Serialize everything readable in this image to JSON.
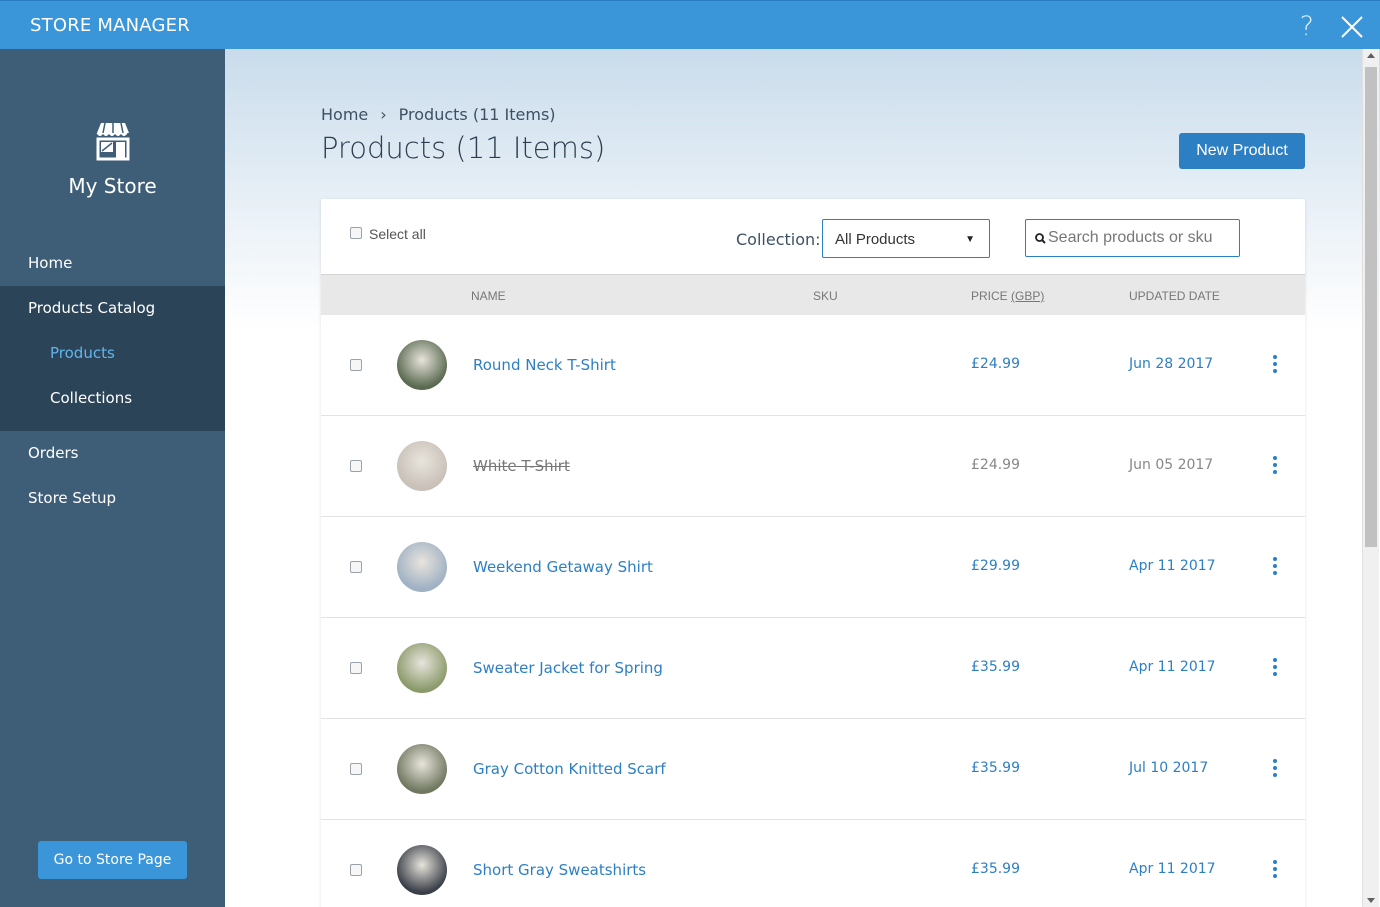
{
  "app": {
    "title": "STORE MANAGER",
    "help_label": "?"
  },
  "sidebar": {
    "store_name": "My Store",
    "items": [
      {
        "label": "Home"
      },
      {
        "label": "Products Catalog"
      },
      {
        "label": "Products"
      },
      {
        "label": "Collections"
      },
      {
        "label": "Orders"
      },
      {
        "label": "Store Setup"
      }
    ],
    "store_button": "Go to Store Page"
  },
  "breadcrumb": {
    "home": "Home",
    "separator": "›",
    "current": "Products (11 Items)"
  },
  "page": {
    "title": "Products (11 Items)",
    "new_button": "New Product"
  },
  "toolbar": {
    "select_all": "Select all",
    "collection_label": "Collection:",
    "collection_value": "All Products",
    "search_placeholder": "Search products or sku"
  },
  "table": {
    "columns": {
      "name": "NAME",
      "sku": "SKU",
      "price": "PRICE",
      "currency": "(GBP)",
      "updated": "UPDATED DATE"
    },
    "rows": [
      {
        "name": "Round Neck T-Shirt",
        "sku": "",
        "price": "£24.99",
        "date": "Jun 28 2017",
        "strike": false,
        "thumb": "#5a6a50"
      },
      {
        "name": "White T-Shirt",
        "sku": "",
        "price": "£24.99",
        "date": "Jun 05 2017",
        "strike": true,
        "thumb": "#c9c0b8"
      },
      {
        "name": "Weekend Getaway Shirt",
        "sku": "",
        "price": "£29.99",
        "date": "Apr 11 2017",
        "strike": false,
        "thumb": "#9fb1c4"
      },
      {
        "name": "Sweater Jacket for Spring",
        "sku": "",
        "price": "£35.99",
        "date": "Apr 11 2017",
        "strike": false,
        "thumb": "#8a9a6a"
      },
      {
        "name": "Gray Cotton Knitted Scarf",
        "sku": "",
        "price": "£35.99",
        "date": "Jul 10 2017",
        "strike": false,
        "thumb": "#707860"
      },
      {
        "name": "Short Gray Sweatshirts",
        "sku": "",
        "price": "£35.99",
        "date": "Apr 11 2017",
        "strike": false,
        "thumb": "#3a3f48"
      }
    ]
  },
  "colors": {
    "accent": "#2d7fc4",
    "topbar": "#3b95d9",
    "sidebar": "#3e5e78",
    "sidebar_group": "#2c4458"
  }
}
